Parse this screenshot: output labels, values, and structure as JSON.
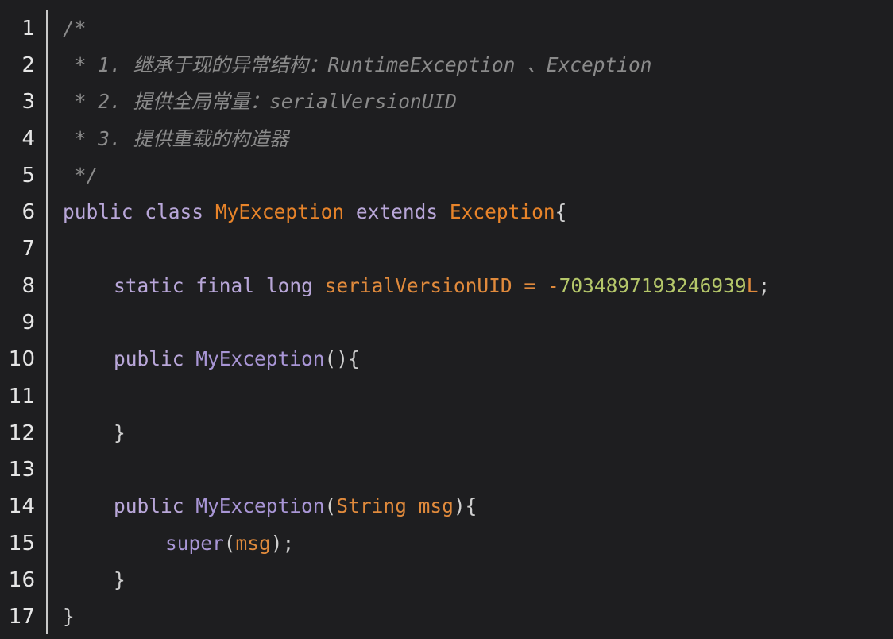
{
  "line_numbers": [
    "1",
    "2",
    "3",
    "4",
    "5",
    "6",
    "7",
    "8",
    "9",
    "10",
    "11",
    "12",
    "13",
    "14",
    "15",
    "16",
    "17"
  ],
  "code": {
    "l1": "/*",
    "l2": " * 1. 继承于现的异常结构：RuntimeException 、Exception",
    "l3": " * 2. 提供全局常量：serialVersionUID",
    "l4": " * 3. 提供重载的构造器",
    "l5": " */",
    "l6": {
      "kw1": "public",
      "kw2": "class",
      "name": "MyException",
      "kw3": "extends",
      "parent": "Exception",
      "brace": "{"
    },
    "l8": {
      "kw1": "static",
      "kw2": "final",
      "kw3": "long",
      "field": "serialVersionUID",
      "eq": "=",
      "minus": "-",
      "number": "7034897193246939",
      "suffix": "L",
      "semi": ";"
    },
    "l10": {
      "kw": "public",
      "name": "MyException",
      "punct": "(){"
    },
    "l12": "}",
    "l14": {
      "kw": "public",
      "name": "MyException",
      "open": "(",
      "type": "String",
      "param": "msg",
      "close": "){"
    },
    "l15": {
      "call": "super",
      "open": "(",
      "arg": "msg",
      "close": ");"
    },
    "l16": "}",
    "l17": "}"
  }
}
